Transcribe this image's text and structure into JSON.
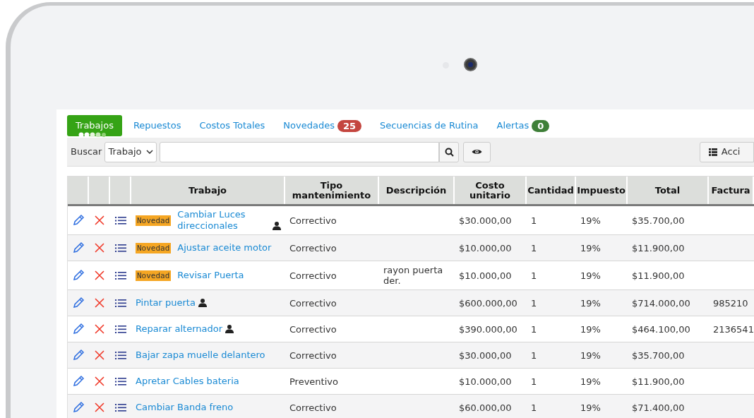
{
  "tabs": [
    {
      "label": "Trabajos",
      "selected": true
    },
    {
      "label": "Repuestos",
      "selected": false
    },
    {
      "label": "Costos Totales",
      "selected": false
    },
    {
      "label": "Novedades",
      "selected": false,
      "badge": {
        "text": "25",
        "color": "#c4463f"
      }
    },
    {
      "label": "Secuencias de Rutina",
      "selected": false
    },
    {
      "label": "Alertas",
      "selected": false,
      "badge": {
        "text": "0",
        "color": "#3e7f38"
      }
    }
  ],
  "search": {
    "label": "Buscar",
    "filter": "Trabajo"
  },
  "actions_button": "Acci",
  "table": {
    "columns": [
      "Trabajo",
      "Tipo mantenimiento",
      "Descripción",
      "Costo unitario",
      "Cantidad",
      "Impuesto",
      "Total",
      "Factura"
    ],
    "rows": [
      {
        "tag": "Novedad",
        "trabajo": "Cambiar Luces direccionales",
        "assigned": true,
        "tipo": "Correctivo",
        "descripcion": "",
        "costo": "$30.000,00",
        "cantidad": "1",
        "impuesto": "19%",
        "total": "$35.700,00",
        "factura": ""
      },
      {
        "tag": "Novedad",
        "trabajo": "Ajustar aceite motor",
        "assigned": false,
        "tipo": "Correctivo",
        "descripcion": "",
        "costo": "$10.000,00",
        "cantidad": "1",
        "impuesto": "19%",
        "total": "$11.900,00",
        "factura": ""
      },
      {
        "tag": "Novedad",
        "trabajo": "Revisar Puerta",
        "assigned": false,
        "tipo": "Correctivo",
        "descripcion": "rayon puerta der.",
        "costo": "$10.000,00",
        "cantidad": "1",
        "impuesto": "19%",
        "total": "$11.900,00",
        "factura": ""
      },
      {
        "trabajo": "Pintar puerta",
        "assigned": true,
        "tipo": "Correctivo",
        "costo": "$600.000,00",
        "cantidad": "1",
        "impuesto": "19%",
        "total": "$714.000,00",
        "factura": "985210"
      },
      {
        "trabajo": "Reparar alternador",
        "assigned": true,
        "tipo": "Correctivo",
        "costo": "$390.000,00",
        "cantidad": "1",
        "impuesto": "19%",
        "total": "$464.100,00",
        "factura": "2136541"
      },
      {
        "trabajo": "Bajar zapa muelle delantero",
        "assigned": false,
        "tipo": "Correctivo",
        "costo": "$30.000,00",
        "cantidad": "1",
        "impuesto": "19%",
        "total": "$35.700,00"
      },
      {
        "trabajo": "Apretar Cables bateria",
        "assigned": false,
        "tipo": "Preventivo",
        "costo": "$10.000,00",
        "cantidad": "1",
        "impuesto": "19%",
        "total": "$11.900,00"
      },
      {
        "trabajo": "Cambiar Banda freno",
        "assigned": false,
        "tipo": "Correctivo",
        "costo": "$60.000,00",
        "cantidad": "1",
        "impuesto": "19%",
        "total": "$71.400,00"
      }
    ]
  }
}
